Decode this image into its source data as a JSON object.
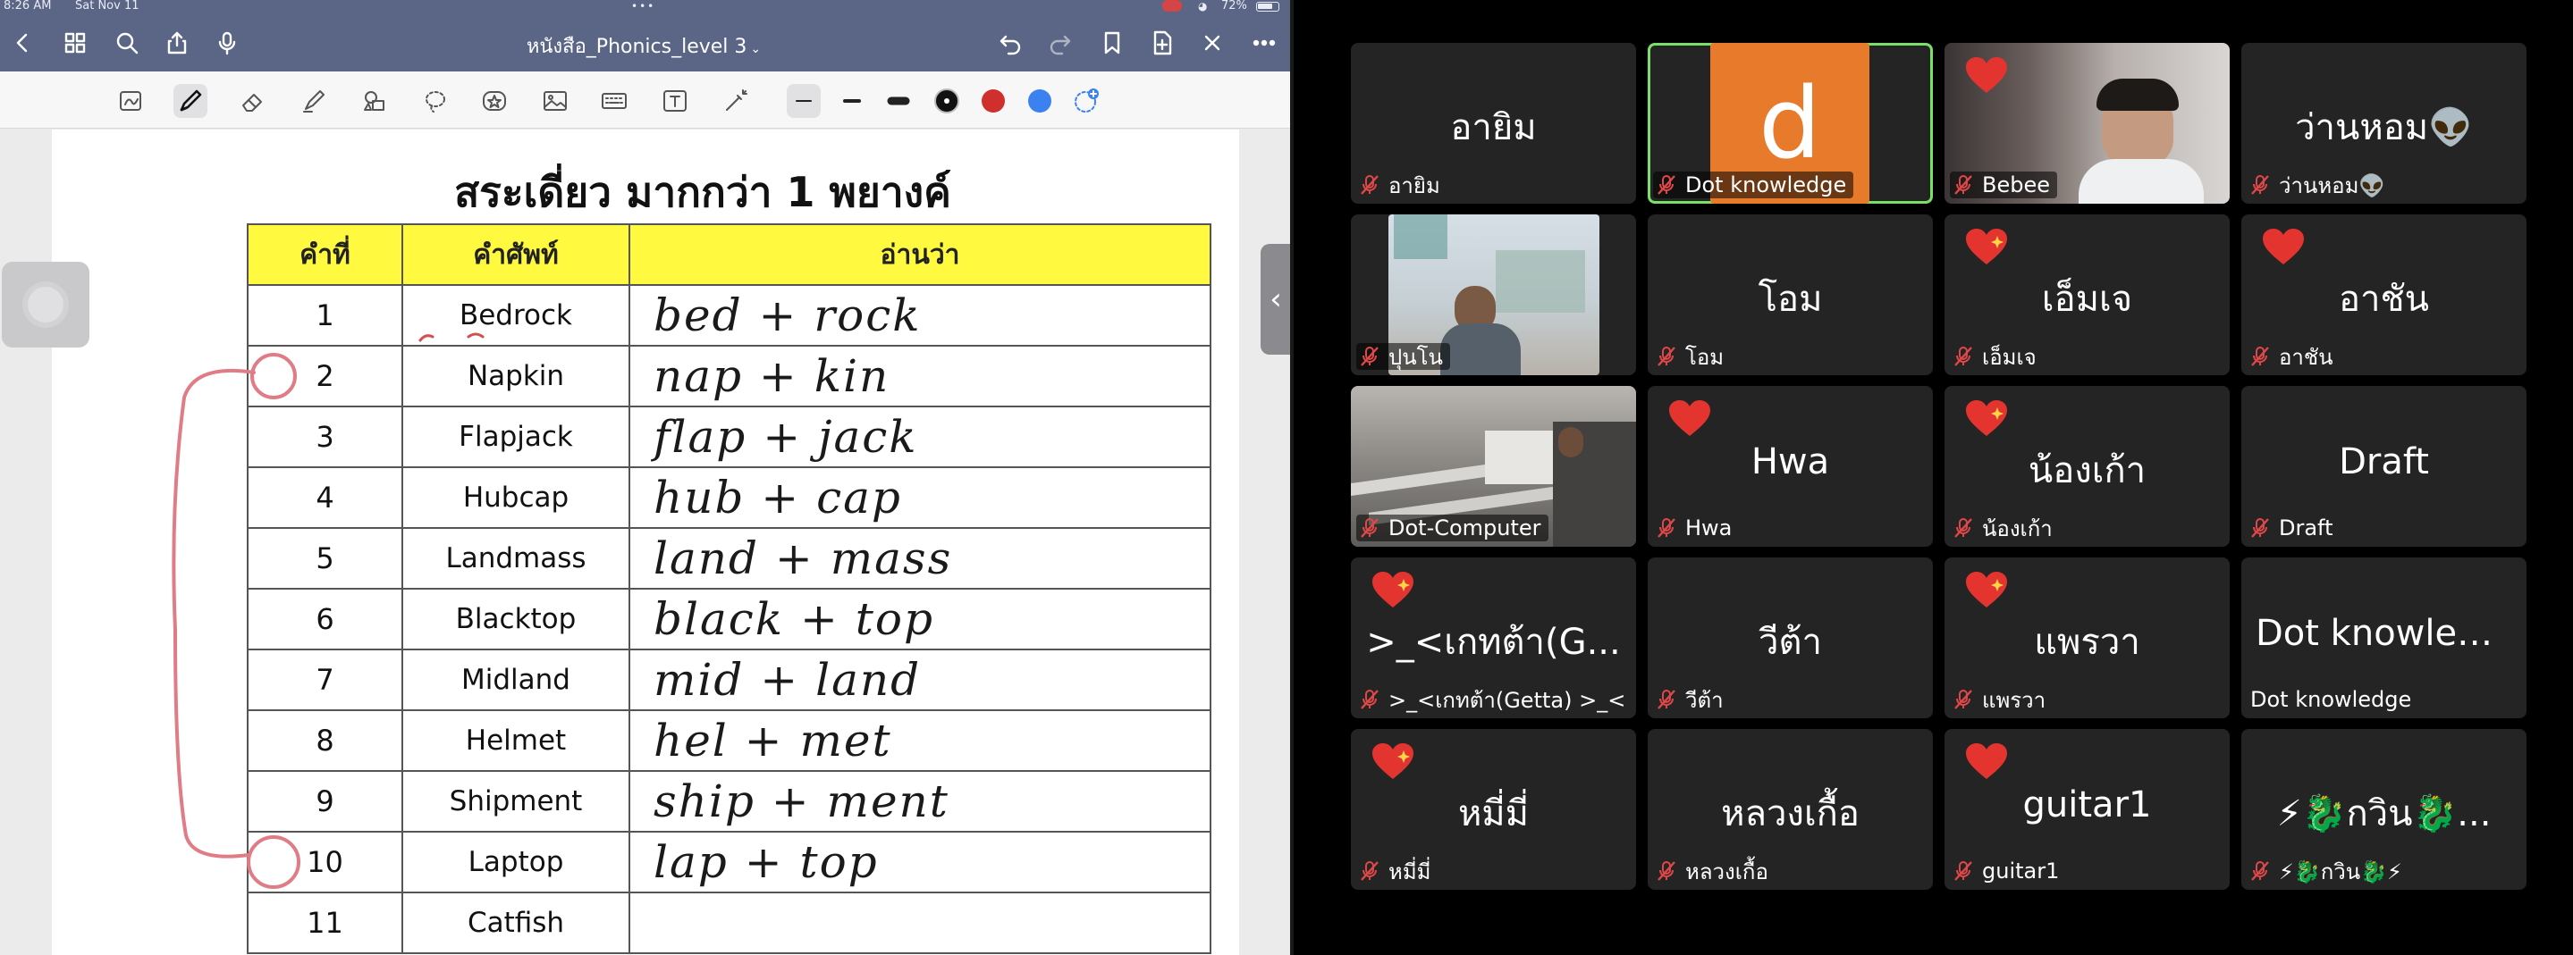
{
  "status_bar": {
    "time": "8:26 AM",
    "date": "Sat Nov 11",
    "grabber": "•••",
    "battery": "72%"
  },
  "notes_app": {
    "document_title": "หนังสือ_Phonics_level 3",
    "sheet": {
      "title": "สระเดี่ยว มากกว่า 1 พยางค์",
      "headers": [
        "คำที่",
        "คำศัพท์",
        "อ่านว่า"
      ],
      "rows": [
        {
          "num": "1",
          "word": "Bedrock",
          "reading": "bed + rock"
        },
        {
          "num": "2",
          "word": "Napkin",
          "reading": "nap + kin"
        },
        {
          "num": "3",
          "word": "Flapjack",
          "reading": "flap + jack"
        },
        {
          "num": "4",
          "word": "Hubcap",
          "reading": "hub + cap"
        },
        {
          "num": "5",
          "word": "Landmass",
          "reading": "land + mass"
        },
        {
          "num": "6",
          "word": "Blacktop",
          "reading": "black + top"
        },
        {
          "num": "7",
          "word": "Midland",
          "reading": "mid + land"
        },
        {
          "num": "8",
          "word": "Helmet",
          "reading": "hel + met"
        },
        {
          "num": "9",
          "word": "Shipment",
          "reading": "ship + ment"
        },
        {
          "num": "10",
          "word": "Laptop",
          "reading": "lap + top"
        },
        {
          "num": "11",
          "word": "Catfish",
          "reading": ""
        }
      ]
    },
    "colors": {
      "bar": "#5b6687",
      "header_fill": "#fff93f",
      "ink_red": "#d34e4e",
      "pen_blue": "#3b82f0",
      "annotation_pink": "#e07c86"
    }
  },
  "meeting": {
    "tiles": [
      {
        "display": "อายิม",
        "label": "อายิม",
        "heart": false,
        "video": false,
        "active": false
      },
      {
        "display": "d",
        "label": "Dot knowledge",
        "heart": false,
        "video": false,
        "avatar": true,
        "active": true
      },
      {
        "display": "",
        "label": "Bebee",
        "heart": true,
        "video": true,
        "active": false
      },
      {
        "display": "ว่านหอม👽",
        "label": "ว่านหอม👽",
        "heart": false,
        "video": false,
        "active": false
      },
      {
        "display": "",
        "label": "ปุนโน",
        "heart": false,
        "video": true,
        "active": false
      },
      {
        "display": "โอม",
        "label": "โอม",
        "heart": false,
        "video": false,
        "active": false
      },
      {
        "display": "เอ็มเจ",
        "label": "เอ็มเจ",
        "heart": true,
        "video": false,
        "active": false
      },
      {
        "display": "อาชัน",
        "label": "อาชัน",
        "heart": true,
        "video": false,
        "active": false
      },
      {
        "display": "",
        "label": "Dot-Computer",
        "heart": false,
        "video": true,
        "active": false
      },
      {
        "display": "Hwa",
        "label": "Hwa",
        "heart": true,
        "video": false,
        "active": false
      },
      {
        "display": "น้องเก้า",
        "label": "น้องเก้า",
        "heart": true,
        "video": false,
        "active": false
      },
      {
        "display": "Draft",
        "label": "Draft",
        "heart": false,
        "video": false,
        "active": false
      },
      {
        "display": ">_<เกทต้า(G...",
        "label": ">_<เกทต้า(Getta)  >_<",
        "heart": true,
        "video": false,
        "active": false
      },
      {
        "display": "วีต้า",
        "label": "วีต้า",
        "heart": false,
        "video": false,
        "active": false
      },
      {
        "display": "แพรวา",
        "label": "แพรวา",
        "heart": true,
        "video": false,
        "active": false
      },
      {
        "display": "Dot knowledge",
        "label": "Dot knowledge",
        "heart": false,
        "video": false,
        "muted": false,
        "active": false
      },
      {
        "display": "หมี่มี่",
        "label": "หมี่มี่",
        "heart": true,
        "video": false,
        "active": false
      },
      {
        "display": "หลวงเกื้อ",
        "label": "หลวงเกื้อ",
        "heart": false,
        "video": false,
        "active": false
      },
      {
        "display": "guitar1",
        "label": "guitar1",
        "heart": true,
        "video": false,
        "active": false
      },
      {
        "display": "⚡🐉กวิน🐉...",
        "label": "⚡🐉กวิน🐉⚡",
        "heart": false,
        "video": false,
        "active": false
      }
    ],
    "colors": {
      "tile": "#242424",
      "active_border": "#7be06a",
      "heart": "#e3342f",
      "mic_off": "#e04848",
      "avatar_bg": "#e87a2c"
    }
  }
}
